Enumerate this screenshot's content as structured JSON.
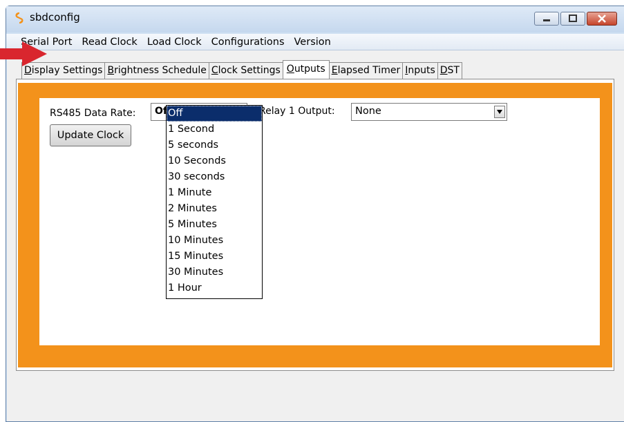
{
  "window": {
    "title": "sbdconfig"
  },
  "menu": {
    "items": [
      "Serial Port",
      "Read Clock",
      "Load Clock",
      "Configurations",
      "Version"
    ]
  },
  "tabs": [
    {
      "label": "Display Settings",
      "accel": "D",
      "rest": "isplay Settings"
    },
    {
      "label": "Brightness Schedule",
      "accel": "B",
      "rest": "rightness Schedule"
    },
    {
      "label": "Clock Settings",
      "accel": "C",
      "rest": "lock Settings"
    },
    {
      "label": "Outputs",
      "accel": "O",
      "rest": "utputs"
    },
    {
      "label": "Elapsed Timer",
      "accel": "E",
      "rest": "lapsed Timer"
    },
    {
      "label": "Inputs",
      "accel": "I",
      "rest": "nputs"
    },
    {
      "label": "DST",
      "accel": "D",
      "rest": "ST"
    }
  ],
  "active_tab": "Outputs",
  "outputs": {
    "rs485_label": "RS485 Data Rate:",
    "rs485_value": "Off",
    "relay1_label": "Relay 1 Output:",
    "relay1_value": "None",
    "update_button": "Update Clock",
    "rate_options": [
      "Off",
      "1 Second",
      "5 seconds",
      "10 Seconds",
      "30 seconds",
      "1 Minute",
      "2 Minutes",
      "5 Minutes",
      "10 Minutes",
      "15 Minutes",
      "30 Minutes",
      "1 Hour"
    ],
    "selected_option": "Off"
  },
  "colors": {
    "panel_orange": "#f3921b",
    "selection_blue": "#0b2d6b",
    "annotation_arrow": "#d9262e"
  },
  "icons": {
    "app": "sbd-logo-icon",
    "minimize": "minimize-icon",
    "maximize": "maximize-icon",
    "close": "close-icon",
    "dropdown": "chevron-down-icon",
    "annotation": "red-arrow-icon"
  }
}
